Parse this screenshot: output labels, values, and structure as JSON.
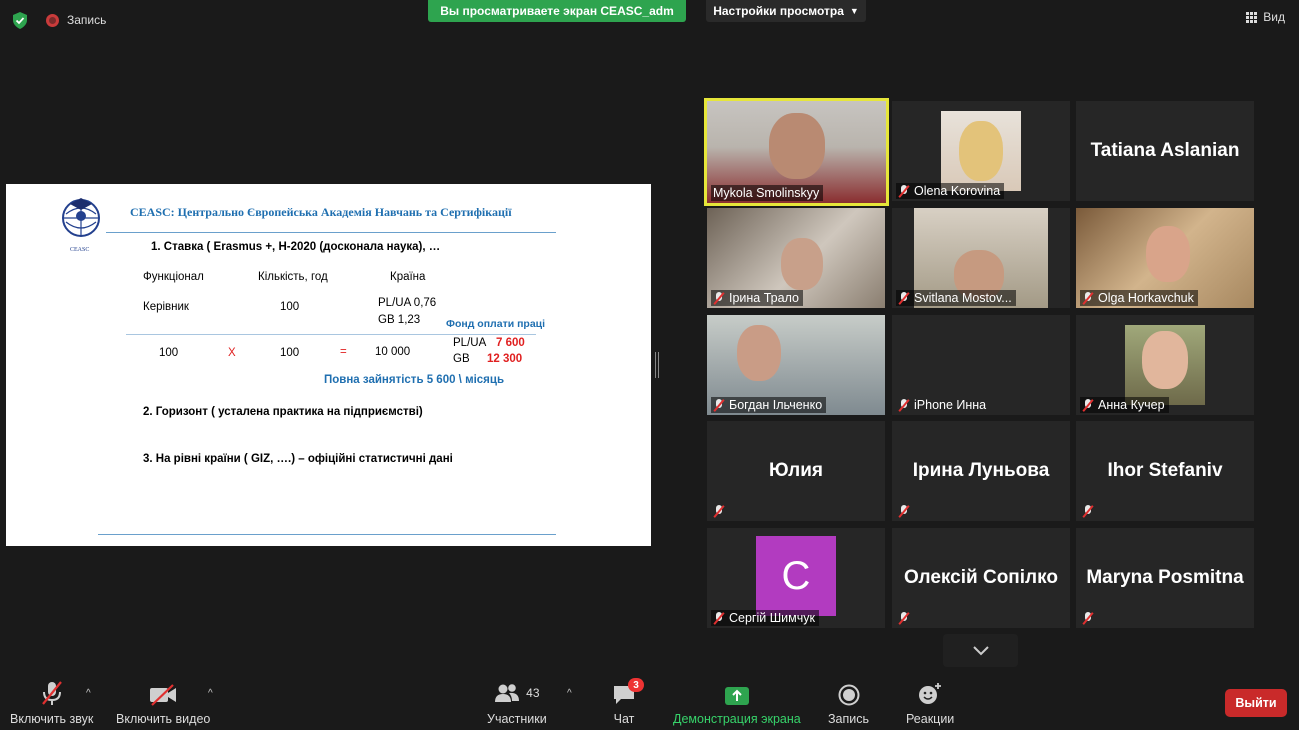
{
  "topbar": {
    "recording_label": "Запись",
    "share_banner": "Вы просматриваете экран CEASC_adm",
    "view_settings": "Настройки просмотра",
    "view_label": "Вид"
  },
  "slide": {
    "logo_text": "CEASC",
    "title": "CEASC:  Центрально Європейська Академія Навчань та Сертифікації",
    "item1": "1. Ставка ( Erasmus +, H-2020 (досконала наука), …",
    "col_func": "Функціонал",
    "col_qty": "Кількість, год",
    "col_country": "Країна",
    "row_role": "Керівник",
    "row_qty": "100",
    "rate_pl": "PL/UA 0,76",
    "rate_gb": "GB 1,23",
    "fund_label": "Фонд оплати праці",
    "calc_a": "100",
    "calc_x": "X",
    "calc_b": "100",
    "calc_eq": "=",
    "calc_result": "10 000",
    "fund_pl_label": "PL/UA",
    "fund_pl_value": "7 600",
    "fund_gb_label": "GB",
    "fund_gb_value": "12 300",
    "full_employment": "Повна зайнятість  5 600 \\ місяць",
    "item2": "2. Горизонт ( усталена практика на підприємстві)",
    "item3": "3. На рівні країни ( GIZ, ….) – офіційні статистичні дані"
  },
  "participants": [
    {
      "name": "Mykola Smolinskyy",
      "muted": false,
      "active": true
    },
    {
      "name": "Olena Korovina",
      "muted": true
    },
    {
      "name": "Tatiana Aslanian",
      "muted": false,
      "no_video": true
    },
    {
      "name": "Ірина Трало",
      "muted": true
    },
    {
      "name": "Svitlana Mostov...",
      "muted": true
    },
    {
      "name": "Olga Horkavchuk",
      "muted": true
    },
    {
      "name": "Богдан Ільченко",
      "muted": true
    },
    {
      "name": "iPhone Инна",
      "muted": true
    },
    {
      "name": "Анна Кучер",
      "muted": true
    },
    {
      "name": "Юлия",
      "muted": true,
      "no_video": true
    },
    {
      "name": "Ірина Луньова",
      "muted": true,
      "no_video": true
    },
    {
      "name": "Ihor Stefaniv",
      "muted": true,
      "no_video": true
    },
    {
      "name": "Сергій Шимчук",
      "muted": true,
      "avatar_letter": "C"
    },
    {
      "name": "Олексій Сопілко",
      "muted": true,
      "no_video": true
    },
    {
      "name": "Maryna Posmitna",
      "muted": true,
      "no_video": true
    }
  ],
  "toolbar": {
    "unmute": "Включить звук",
    "start_video": "Включить видео",
    "participants": "Участники",
    "participants_count": "43",
    "chat": "Чат",
    "chat_badge": "3",
    "share_screen": "Демонстрация экрана",
    "record": "Запись",
    "reactions": "Реакции",
    "leave": "Выйти"
  },
  "colors": {
    "active_speaker": "#e6e63a",
    "share_green": "#2ea44f",
    "leave_red": "#c92a2a",
    "slide_blue": "#1f6fb0",
    "slide_red": "#e02020"
  }
}
